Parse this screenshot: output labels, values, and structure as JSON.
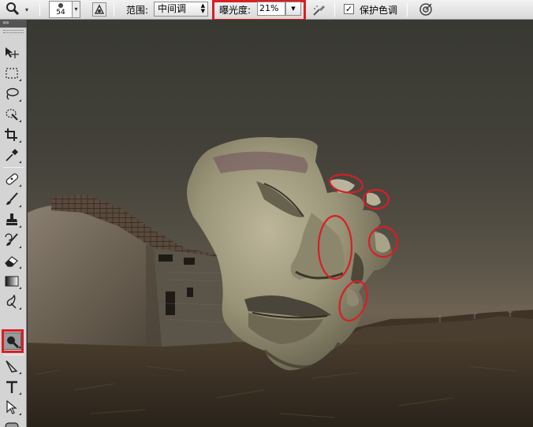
{
  "options_bar": {
    "brush_size": "54",
    "range_label": "范围:",
    "range_value": "中间调",
    "exposure_label": "曝光度:",
    "exposure_value": "21%",
    "protect_tones_label": "保护色调",
    "protect_tones_checked": "✓"
  },
  "toolbar": {
    "selected_tool": "burn-tool"
  },
  "annotations": {
    "highlight_color": "#d61f26"
  },
  "icons": [
    "burn-tool-icon",
    "brush-preset-icon",
    "airbrush-icon",
    "pressure-icon",
    "sample-all-layers-icon",
    "move-icon",
    "marquee-icon",
    "lasso-icon",
    "quick-select-icon",
    "crop-icon",
    "eyedropper-icon",
    "healing-brush-icon",
    "brush-icon",
    "clone-stamp-icon",
    "history-brush-icon",
    "eraser-icon",
    "gradient-icon",
    "blur-icon",
    "path-select-icon",
    "type-icon",
    "direct-select-icon",
    "rounded-rect-icon"
  ]
}
